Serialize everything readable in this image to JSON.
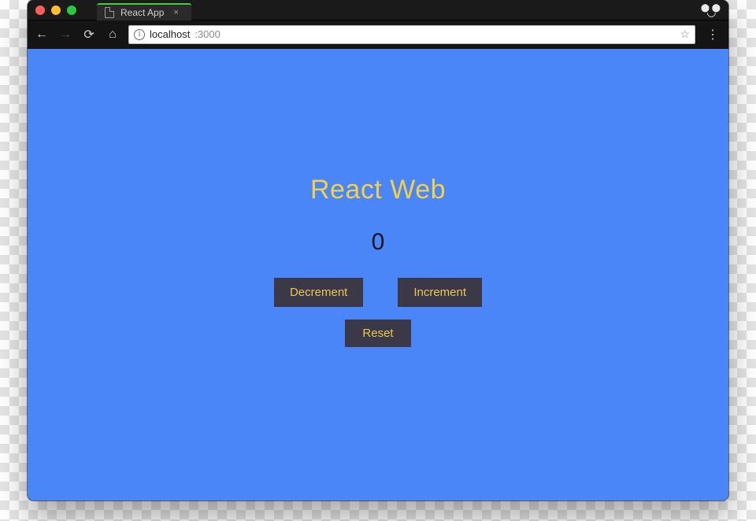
{
  "browser": {
    "tab_title": "React App",
    "url_host": "localhost",
    "url_port": ":3000",
    "icons": {
      "close": "close-icon",
      "back": "back-icon",
      "forward": "forward-icon",
      "reload": "reload-icon",
      "home": "home-icon",
      "info": "info-icon",
      "star": "star-icon",
      "menu": "menu-icon",
      "incognito": "incognito-icon",
      "doc": "document-icon"
    }
  },
  "app": {
    "title": "React Web",
    "counter_value": "0",
    "buttons": {
      "decrement": "Decrement",
      "increment": "Increment",
      "reset": "Reset"
    }
  },
  "colors": {
    "page_bg": "#4a86f7",
    "title_color": "#f2d04a",
    "button_bg": "#3b3947",
    "button_fg": "#e8c94e"
  }
}
